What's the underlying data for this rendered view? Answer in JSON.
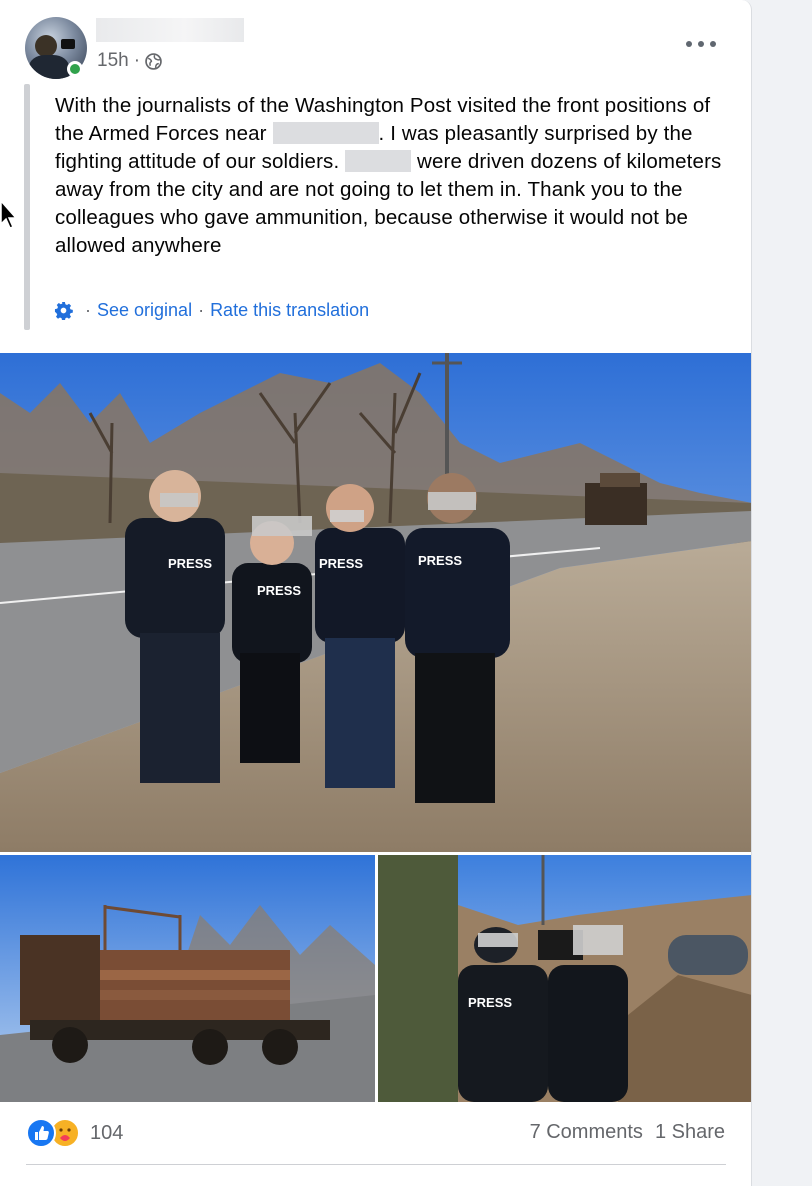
{
  "post": {
    "timestamp": "15h",
    "privacy_icon": "globe-icon",
    "text": {
      "part1": "With the journalists of the Washington Post visited the front positions of the Armed Forces near ",
      "part2": ". I was pleasantly surprised by the fighting attitude of our soldiers. ",
      "part3": " were driven dozens of kilometers away from the city and are not going to let them in. Thank you to the colleagues who gave ammunition, because otherwise it would not be allowed anywhere"
    },
    "translation": {
      "see_original": "See original",
      "rate": "Rate this translation"
    },
    "photos": {
      "main_press1": "PRESS",
      "main_press2": "PRESS",
      "main_press3": "PRESS",
      "main_press4": "PRESS",
      "right_press": "PRESS"
    }
  },
  "footer": {
    "reaction_count": "104",
    "comments": "7 Comments",
    "shares": "1 Share"
  },
  "colors": {
    "accent": "#216fdb",
    "like": "#1877f2",
    "online": "#31a24c"
  }
}
